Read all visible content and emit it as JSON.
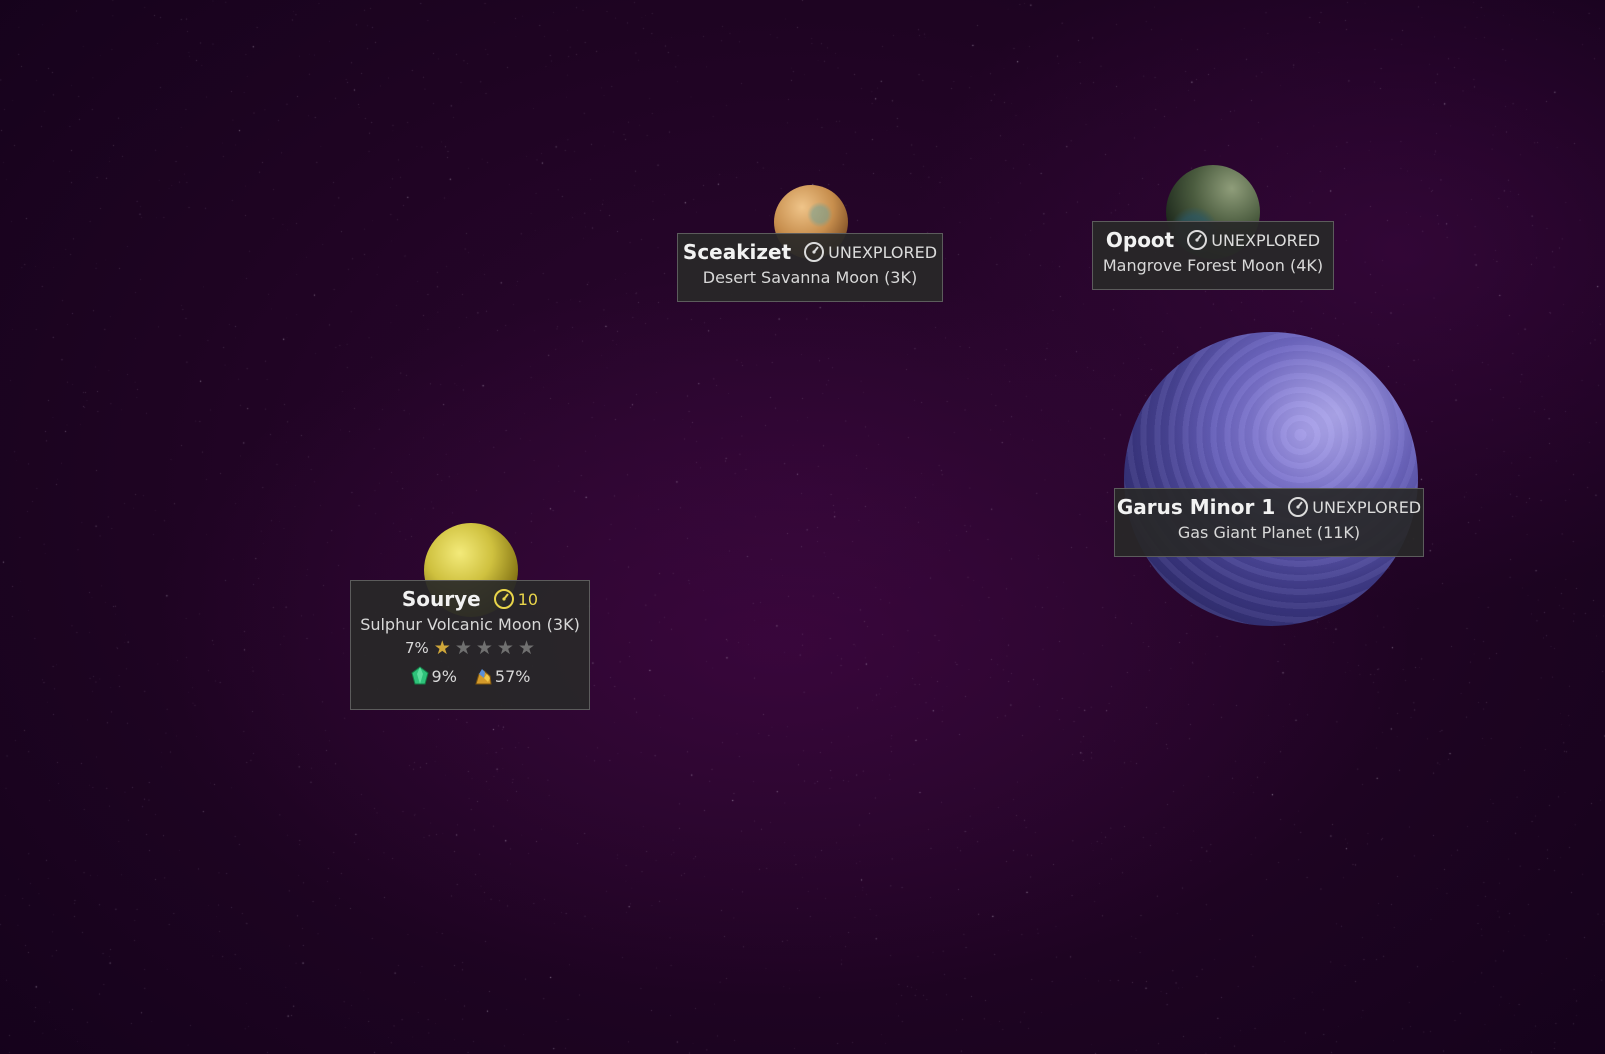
{
  "planets": [
    {
      "name": "Sourye",
      "status": "10",
      "type": "Sulphur Volcanic Moon (3K)",
      "rating_percent": "7%",
      "rating_stars": 0.3,
      "rating_max": 5,
      "resources": [
        {
          "icon": "green-crystal-icon",
          "value": "9%"
        },
        {
          "icon": "gold-ore-icon",
          "value": "57%"
        }
      ],
      "status_color": "#e9d54a"
    },
    {
      "name": "Sceakizet",
      "status": "UNEXPLORED",
      "type": "Desert Savanna Moon (3K)"
    },
    {
      "name": "Opoot",
      "status": "UNEXPLORED",
      "type": "Mangrove Forest Moon (4K)"
    },
    {
      "name": "Garus Minor 1",
      "status": "UNEXPLORED",
      "type": "Gas Giant Planet (11K)"
    }
  ],
  "colors": {
    "panel_bg": "#282828",
    "space_bg": "#1e0422",
    "accent_gold": "#e9d54a"
  }
}
